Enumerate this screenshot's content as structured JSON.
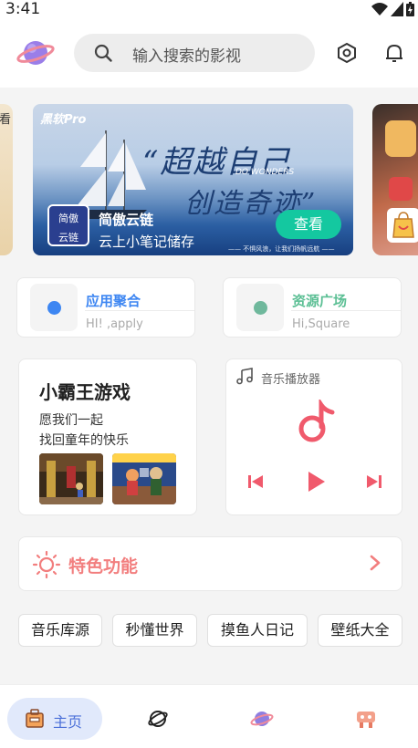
{
  "status": {
    "time": "3:41"
  },
  "search": {
    "placeholder": "输入搜索的影视"
  },
  "banner": {
    "peek_left_text": "看",
    "brand": "黑软Pro",
    "headline1": "“超越自己",
    "subtitle_en": "DO WONDERS",
    "headline2": "创造奇迹”",
    "badge_line1": "简傲",
    "badge_line2": "云链",
    "app_name": "简傲云链",
    "app_desc": "云上小笔记储存",
    "cta": "查看",
    "motto": "—— 不惧风浪，让我们扬帆远航 ——"
  },
  "quick_links": [
    {
      "title": "应用聚合",
      "subtitle": "HI! ,apply",
      "color": "#3d86f2",
      "title_color": "#3d86f2"
    },
    {
      "title": "资源广场",
      "subtitle": "Hi,Square",
      "color": "#6fb89c",
      "title_color": "#5bbf94"
    }
  ],
  "game_card": {
    "title": "小霸王游戏",
    "line1": "愿我们一起",
    "line2": "找回童年的快乐"
  },
  "music_card": {
    "title": "音乐播放器",
    "accent": "#f05a6c"
  },
  "feature": {
    "label": "特色功能",
    "color": "#f27e7e"
  },
  "tags": [
    "音乐库源",
    "秒懂世界",
    "摸鱼人日记",
    "壁纸大全"
  ],
  "bottom_nav": [
    {
      "label": "主页",
      "icon": "home-icon",
      "active": true
    },
    {
      "label": "",
      "icon": "planet-outline-icon",
      "active": false
    },
    {
      "label": "",
      "icon": "planet-icon",
      "active": false
    },
    {
      "label": "",
      "icon": "game-icon",
      "active": false
    }
  ]
}
